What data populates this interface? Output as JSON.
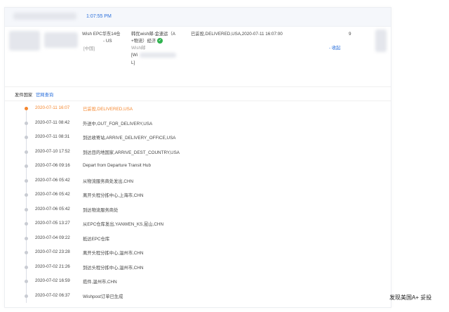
{
  "header": {
    "time": "1:07:55 PM"
  },
  "order": {
    "channel_line1": "Wish EPC华东14仓",
    "channel_line2": "- US",
    "channel_tag": "[中国]",
    "service_line1": "韩优wish邮-金速运（A",
    "service_line2": "+物流）经济",
    "service_platform": "Wish邮",
    "service_bracket_open": "[Wi",
    "service_bracket_close": "L]",
    "status": "已妥投,DELIVERED,USA,2020-07-11 16:07:00",
    "collapse_link": "- 收起",
    "count": "9"
  },
  "section": {
    "label": "发件国家",
    "link": "官网查询"
  },
  "timeline": [
    {
      "time": "2020-07-11 16:07",
      "desc": "已妥投,DELIVERED,USA",
      "active": true
    },
    {
      "time": "2020-07-11 08:42",
      "desc": "外送中,OUT_FOR_DELIVERY,USA"
    },
    {
      "time": "2020-07-11 08:31",
      "desc": "到达收寄站,ARRIVE_DELIVERY_OFFICE,USA"
    },
    {
      "time": "2020-07-10 17:52",
      "desc": "到达目的地国家,ARRIVE_DEST_COUNTRY,USA"
    },
    {
      "time": "2020-07-06 09:16",
      "desc": "Depart from Departure Transit Hub"
    },
    {
      "time": "2020-07-06 05:42",
      "desc": "从物流服务商处发出,CHN"
    },
    {
      "time": "2020-07-06 05:42",
      "desc": "离开头程分拣中心,上海市,CHN"
    },
    {
      "time": "2020-07-06 05:42",
      "desc": "到达物流服务商处"
    },
    {
      "time": "2020-07-05 13:27",
      "desc": "从EPC仓库发出,YANWEN_KS,昆山,CHN"
    },
    {
      "time": "2020-07-04 09:22",
      "desc": "抵达EPC仓库"
    },
    {
      "time": "2020-07-02 23:28",
      "desc": "离开头程分拣中心,温州市,CHN"
    },
    {
      "time": "2020-07-02 21:26",
      "desc": "到达头程分拣中心,温州市,CHN"
    },
    {
      "time": "2020-07-02 16:59",
      "desc": "揽件,温州市,CHN"
    },
    {
      "time": "2020-07-02 06:37",
      "desc": "Wishpost订单已生成"
    }
  ],
  "side_caption": "发现美国A+ 妥投",
  "colors": {
    "accent": "#2a6fdb",
    "active": "#f5862d",
    "success": "#2fb24e"
  }
}
